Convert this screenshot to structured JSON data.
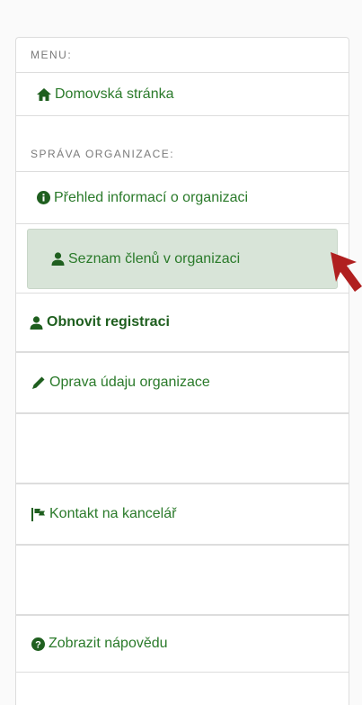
{
  "menu": {
    "header_menu": "MENU:",
    "home_label": "Domovská stránka",
    "header_org": "SPRÁVA ORGANIZACE:",
    "overview_label": "Přehled informací o organizaci",
    "members_label": "Seznam členů v organizaci",
    "renew_label": "Obnovit registraci",
    "edit_label": "Oprava údaju organizace",
    "contact_label": "Kontakt na kancelář",
    "help_label": "Zobrazit nápovědu"
  },
  "colors": {
    "accent_green": "#2a7a2a",
    "active_bg": "#d8e4d8",
    "pointer_arrow": "#b02020"
  },
  "icons": {
    "home": "home-icon",
    "info": "info-icon",
    "user": "user-icon",
    "pencil": "pencil-icon",
    "flag": "flag-icon",
    "help": "help-icon"
  }
}
